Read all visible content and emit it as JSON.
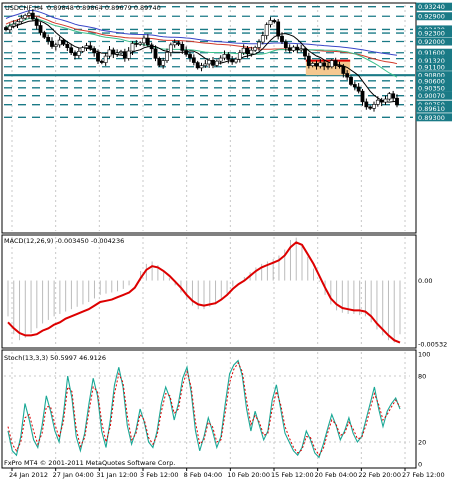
{
  "header": {
    "symbol": "USDCHF,H4",
    "ohlc": "0.89848 0.89864 0.89679 0.89740"
  },
  "colors": {
    "price_labels_bg": "#1a7a86",
    "levels": "#1a7a86",
    "ma_fast": "#000000",
    "ma_mid": "#3cc08c",
    "ma_slow": "#d23a2a",
    "ma_long": "#3a46c8",
    "macd_signal": "#dd0000",
    "macd_hist": "#bbbbbb",
    "stoch_main": "#1aa896",
    "stoch_signal": "#dd0000",
    "box": "#f5c890",
    "box_line": "#dd0000"
  },
  "chart_data": [
    {
      "type": "candlestick",
      "title": "USDCHF,H4",
      "ohlc_header": "0.89848 0.89864 0.89679 0.89740",
      "ylim": [
        0.8525,
        0.933
      ],
      "price_labels": [
        "0.93240",
        "0.92900",
        "0.92430",
        "0.92300",
        "0.92000",
        "0.91600",
        "0.91390",
        "0.91320",
        "0.91100",
        "0.90800",
        "0.90600",
        "0.90350",
        "0.90070",
        "0.89750",
        "0.89610",
        "0.89300"
      ],
      "levels_dashed": [
        0.9324,
        0.929,
        0.9243,
        0.923,
        0.92,
        0.916,
        0.9139,
        0.911,
        0.906,
        0.9035,
        0.9007,
        0.8975,
        0.893
      ],
      "level_solid": 0.908,
      "range_box": {
        "high": 0.9132,
        "low": 0.908,
        "bars": [
          79,
          89
        ]
      },
      "x_tick_labels": [
        "24 Jan 2012",
        "27 Jan 04:00",
        "31 Jan 12:00",
        "3 Feb 12:00",
        "8 Feb 04:00",
        "10 Feb 20:00",
        "15 Feb 12:00",
        "20 Feb 04:00",
        "22 Feb 20:00",
        "27 Feb 12:00"
      ],
      "close": [
        0.9242,
        0.9255,
        0.9262,
        0.9271,
        0.9283,
        0.9293,
        0.9301,
        0.928,
        0.9257,
        0.9232,
        0.9215,
        0.9201,
        0.9182,
        0.9188,
        0.9205,
        0.919,
        0.9178,
        0.916,
        0.915,
        0.9165,
        0.9178,
        0.9185,
        0.9175,
        0.916,
        0.913,
        0.9125,
        0.9148,
        0.917,
        0.9155,
        0.916,
        0.9164,
        0.914,
        0.9166,
        0.9193,
        0.919,
        0.9195,
        0.9212,
        0.9188,
        0.9174,
        0.914,
        0.9115,
        0.9132,
        0.9161,
        0.9188,
        0.9196,
        0.919,
        0.9168,
        0.9154,
        0.9142,
        0.9125,
        0.9106,
        0.9114,
        0.912,
        0.9133,
        0.9115,
        0.913,
        0.9141,
        0.9154,
        0.9136,
        0.9127,
        0.9137,
        0.916,
        0.9176,
        0.9156,
        0.9169,
        0.9179,
        0.9198,
        0.9221,
        0.926,
        0.9275,
        0.927,
        0.9219,
        0.9199,
        0.9178,
        0.9168,
        0.918,
        0.917,
        0.9174,
        0.9148,
        0.9114,
        0.9122,
        0.9112,
        0.9124,
        0.9112,
        0.911,
        0.9132,
        0.9114,
        0.9112,
        0.9086,
        0.9073,
        0.9047,
        0.9038,
        0.9023,
        0.8985,
        0.8967,
        0.8962,
        0.8976,
        0.8991,
        0.8984,
        0.8995,
        0.9014,
        0.8998,
        0.8974
      ],
      "indicators": [
        "MA fast (black)",
        "MA mid (green)",
        "MA slow (red)",
        "MA long (blue)"
      ]
    },
    {
      "type": "line",
      "title": "MACD(12,26,9) -0.003450 -0.004236",
      "ylim": [
        -0.00532,
        0.0034
      ],
      "y_tick_labels": [
        "0.00",
        "-0.00532"
      ],
      "series": [
        {
          "name": "Signal",
          "values": [
            -0.0035,
            -0.004,
            -0.0044,
            -0.0046,
            -0.0046,
            -0.0045,
            -0.0042,
            -0.004,
            -0.0037,
            -0.0035,
            -0.0032,
            -0.003,
            -0.0028,
            -0.0026,
            -0.0024,
            -0.0021,
            -0.0018,
            -0.0017,
            -0.0016,
            -0.0014,
            -0.0012,
            -0.001,
            -0.0006,
            0.0002,
            0.0009,
            0.0012,
            0.0011,
            0.0008,
            0.0004,
            -0.0001,
            -0.0006,
            -0.0012,
            -0.0017,
            -0.002,
            -0.0021,
            -0.002,
            -0.0019,
            -0.0016,
            -0.0012,
            -0.0007,
            -0.0003,
            0.0,
            0.0004,
            0.0008,
            0.0011,
            0.0013,
            0.0015,
            0.0017,
            0.0021,
            0.0028,
            0.0032,
            0.003,
            0.0022,
            0.0014,
            0.0004,
            -0.0006,
            -0.0015,
            -0.002,
            -0.0023,
            -0.0024,
            -0.0025,
            -0.0025,
            -0.0026,
            -0.003,
            -0.0036,
            -0.0041,
            -0.0046,
            -0.005,
            -0.0052
          ]
        },
        {
          "name": "Histogram",
          "values": [
            -0.003,
            -0.0045,
            -0.005,
            -0.0048,
            -0.0044,
            -0.004,
            -0.0036,
            -0.0033,
            -0.003,
            -0.0028,
            -0.0026,
            -0.0024,
            -0.0022,
            -0.002,
            -0.0018,
            -0.0015,
            -0.0012,
            -0.0011,
            -0.001,
            -0.0009,
            -0.0007,
            -0.0004,
            0.0,
            0.0008,
            0.0014,
            0.0016,
            0.0013,
            0.0008,
            0.0002,
            -0.0004,
            -0.001,
            -0.0016,
            -0.0021,
            -0.0024,
            -0.0024,
            -0.0022,
            -0.002,
            -0.0016,
            -0.0011,
            -0.0005,
            0.0,
            0.0003,
            0.0007,
            0.0011,
            0.0014,
            0.0016,
            0.0018,
            0.0021,
            0.0026,
            0.0034,
            0.0036,
            0.003,
            0.002,
            0.001,
            -0.0001,
            -0.0012,
            -0.002,
            -0.0025,
            -0.0027,
            -0.0028,
            -0.0028,
            -0.0029,
            -0.003,
            -0.0035,
            -0.0041,
            -0.0046,
            -0.005,
            -0.0052,
            -0.0045
          ]
        }
      ]
    },
    {
      "type": "line",
      "title": "Stoch(13,3,3) 50.5997 46.9126",
      "ylim": [
        0,
        100
      ],
      "y_tick_labels": [
        "100",
        "80",
        "20",
        "0"
      ],
      "series": [
        {
          "name": "Main",
          "values": [
            30,
            12,
            8,
            25,
            55,
            40,
            22,
            15,
            35,
            62,
            48,
            30,
            20,
            45,
            80,
            60,
            25,
            12,
            28,
            55,
            78,
            62,
            30,
            15,
            40,
            72,
            88,
            70,
            35,
            18,
            30,
            50,
            38,
            20,
            15,
            30,
            55,
            70,
            60,
            40,
            55,
            78,
            88,
            65,
            30,
            12,
            25,
            42,
            30,
            15,
            25,
            55,
            82,
            90,
            94,
            80,
            50,
            30,
            48,
            35,
            22,
            30,
            58,
            72,
            50,
            28,
            20,
            12,
            8,
            15,
            30,
            22,
            10,
            6,
            18,
            32,
            45,
            35,
            22,
            30,
            42,
            28,
            20,
            25,
            40,
            55,
            70,
            50,
            34,
            48,
            55,
            60,
            50
          ]
        },
        {
          "name": "Signal",
          "values": [
            34,
            18,
            12,
            20,
            42,
            45,
            30,
            18,
            28,
            52,
            52,
            36,
            24,
            38,
            70,
            66,
            32,
            16,
            24,
            48,
            70,
            66,
            38,
            20,
            34,
            64,
            82,
            74,
            44,
            22,
            27,
            45,
            40,
            24,
            18,
            26,
            48,
            64,
            62,
            46,
            50,
            72,
            84,
            70,
            38,
            18,
            22,
            38,
            34,
            20,
            22,
            47,
            74,
            86,
            92,
            84,
            58,
            36,
            44,
            38,
            26,
            28,
            50,
            66,
            54,
            34,
            24,
            15,
            10,
            13,
            25,
            24,
            14,
            8,
            14,
            28,
            40,
            36,
            26,
            28,
            38,
            32,
            23,
            24,
            35,
            50,
            64,
            54,
            40,
            45,
            52,
            58,
            52
          ]
        }
      ]
    }
  ],
  "footer": {
    "copyright": "FxPro MT4 © 2001-2011 MetaQuotes Software Corp."
  },
  "macd_label": "MACD(12,26,9) -0.003450 -0.004236",
  "stoch_label": "Stoch(13,3,3) 50.5997 46.9126"
}
